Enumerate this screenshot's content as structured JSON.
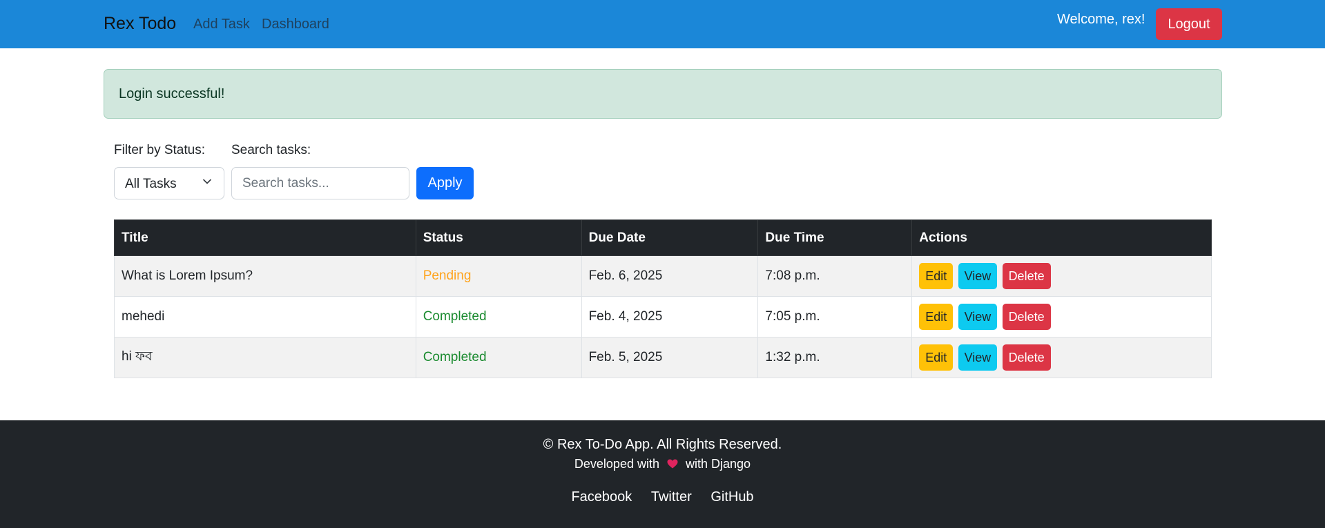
{
  "navbar": {
    "brand": "Rex Todo",
    "links": [
      "Add Task",
      "Dashboard"
    ],
    "welcome": "Welcome, rex!",
    "logout": "Logout",
    "bg_color": "#1b87d8"
  },
  "alert": {
    "message": "Login successful!",
    "type": "success"
  },
  "filter": {
    "status_label": "Filter by Status:",
    "status_selected": "All Tasks",
    "search_label": "Search tasks:",
    "search_placeholder": "Search tasks...",
    "search_value": "",
    "apply_label": "Apply"
  },
  "table": {
    "headers": [
      "Title",
      "Status",
      "Due Date",
      "Due Time",
      "Actions"
    ],
    "rows": [
      {
        "title": "What is Lorem Ipsum?",
        "status": "Pending",
        "due_date": "Feb. 6, 2025",
        "due_time": "7:08 p.m."
      },
      {
        "title": "mehedi",
        "status": "Completed",
        "due_date": "Feb. 4, 2025",
        "due_time": "7:05 p.m."
      },
      {
        "title": "hi ফব",
        "status": "Completed",
        "due_date": "Feb. 5, 2025",
        "due_time": "1:32 p.m."
      }
    ],
    "actions": {
      "edit": "Edit",
      "view": "View",
      "delete": "Delete"
    }
  },
  "footer": {
    "copyright": "© Rex To-Do App. All Rights Reserved.",
    "dev_prefix": "Developed with",
    "dev_suffix": "with Django",
    "heart_icon": "heart-icon",
    "links": [
      "Facebook",
      "Twitter",
      "GitHub"
    ]
  }
}
